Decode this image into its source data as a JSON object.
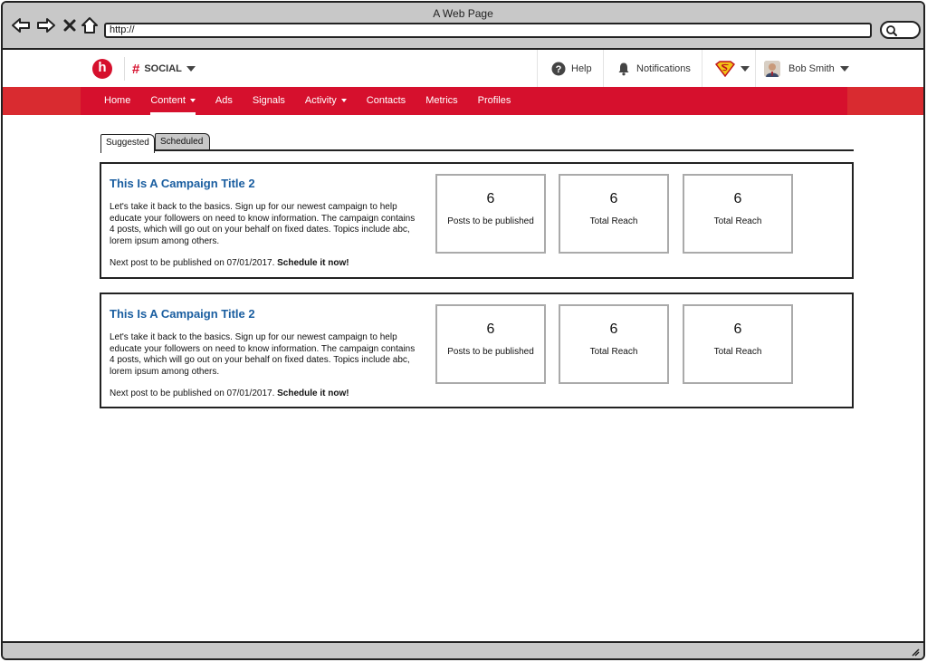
{
  "browser": {
    "page_title": "A Web Page",
    "url": "http://"
  },
  "header": {
    "logo_letter": "h",
    "product_hash": "#",
    "product_name": "SOCIAL",
    "help_label": "Help",
    "notifications_label": "Notifications",
    "user_name": "Bob Smith"
  },
  "nav": {
    "items": [
      {
        "label": "Home"
      },
      {
        "label": "Content"
      },
      {
        "label": "Ads"
      },
      {
        "label": "Signals"
      },
      {
        "label": "Activity"
      },
      {
        "label": "Contacts"
      },
      {
        "label": "Metrics"
      },
      {
        "label": "Profiles"
      }
    ]
  },
  "tabs": {
    "suggested": "Suggested",
    "scheduled": "Scheduled"
  },
  "campaigns": [
    {
      "title": "This Is A Campaign Title 2",
      "description": "Let's take it back to the basics. Sign up for our newest campaign to help educate your followers on need to know information. The campaign contains 4 posts, which will go out on your behalf on fixed dates. Topics include abc, lorem ipsum among others.",
      "next_post_text": "Next post to be published on 07/01/2017.",
      "schedule_cta": "Schedule it now!",
      "stats": [
        {
          "value": "6",
          "label": "Posts to be published"
        },
        {
          "value": "6",
          "label": "Total Reach"
        },
        {
          "value": "6",
          "label": "Total Reach"
        }
      ]
    },
    {
      "title": "This Is A Campaign Title 2",
      "description": "Let's take it back to the basics. Sign up for our newest campaign to help educate your followers on need to know information. The campaign contains 4 posts, which will go out on your behalf on fixed dates. Topics include abc, lorem ipsum among others.",
      "next_post_text": "Next post to be published on 07/01/2017.",
      "schedule_cta": "Schedule it now!",
      "stats": [
        {
          "value": "6",
          "label": "Posts to be published"
        },
        {
          "value": "6",
          "label": "Total Reach"
        },
        {
          "value": "6",
          "label": "Total Reach"
        }
      ]
    }
  ],
  "colors": {
    "brand_red": "#d6102d",
    "title_blue": "#1a5ea0"
  }
}
